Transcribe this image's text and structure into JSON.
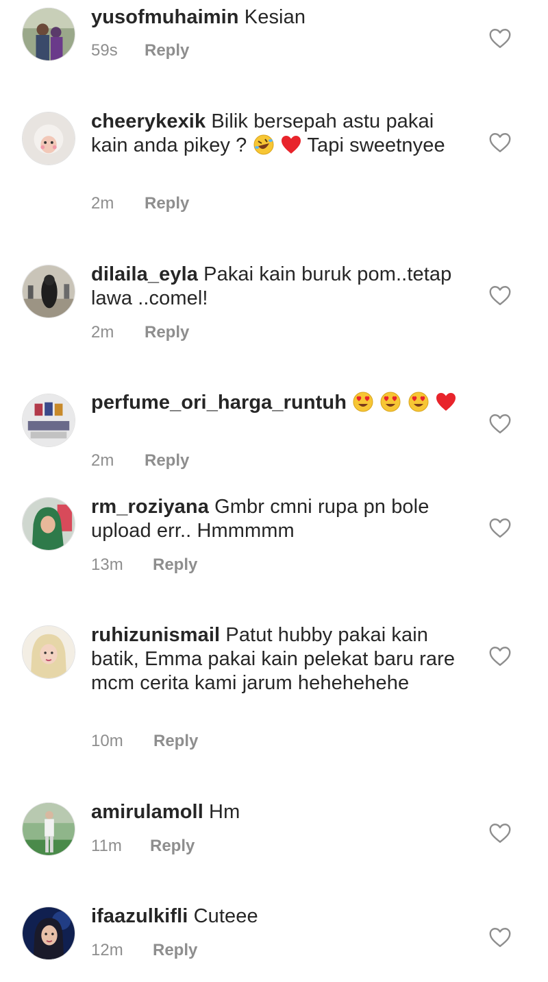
{
  "reply_label": "Reply",
  "like_icon": "heart-outline-icon",
  "comments": [
    {
      "username": "yusofmuhaimin",
      "text": "Kesian",
      "time": "59s"
    },
    {
      "username": "cheerykexik",
      "text_a": "Bilik bersepah astu pakai kain anda pikey ?",
      "text_b": "Tapi sweetnyee",
      "emojis": [
        "rolling-on-floor-laughing",
        "red-heart"
      ],
      "time": "2m"
    },
    {
      "username": "dilaila_eyla",
      "text": "Pakai kain buruk pom..tetap lawa ..comel!",
      "time": "2m"
    },
    {
      "username": "perfume_ori_harga_runtuh",
      "emojis": [
        "heart-eyes",
        "heart-eyes",
        "heart-eyes",
        "red-heart"
      ],
      "time": "2m"
    },
    {
      "username": "rm_roziyana",
      "text": "Gmbr cmni rupa pn bole upload err.. Hmmmmm",
      "time": "13m"
    },
    {
      "username": "ruhizunismail",
      "text": "Patut hubby pakai kain batik, Emma pakai kain pelekat baru rare mcm cerita kami jarum hehehehehe",
      "time": "10m"
    },
    {
      "username": "amirulamoll",
      "text": "Hm",
      "time": "11m"
    },
    {
      "username": "ifaazulkifli",
      "text": "Cuteee",
      "time": "12m"
    }
  ]
}
